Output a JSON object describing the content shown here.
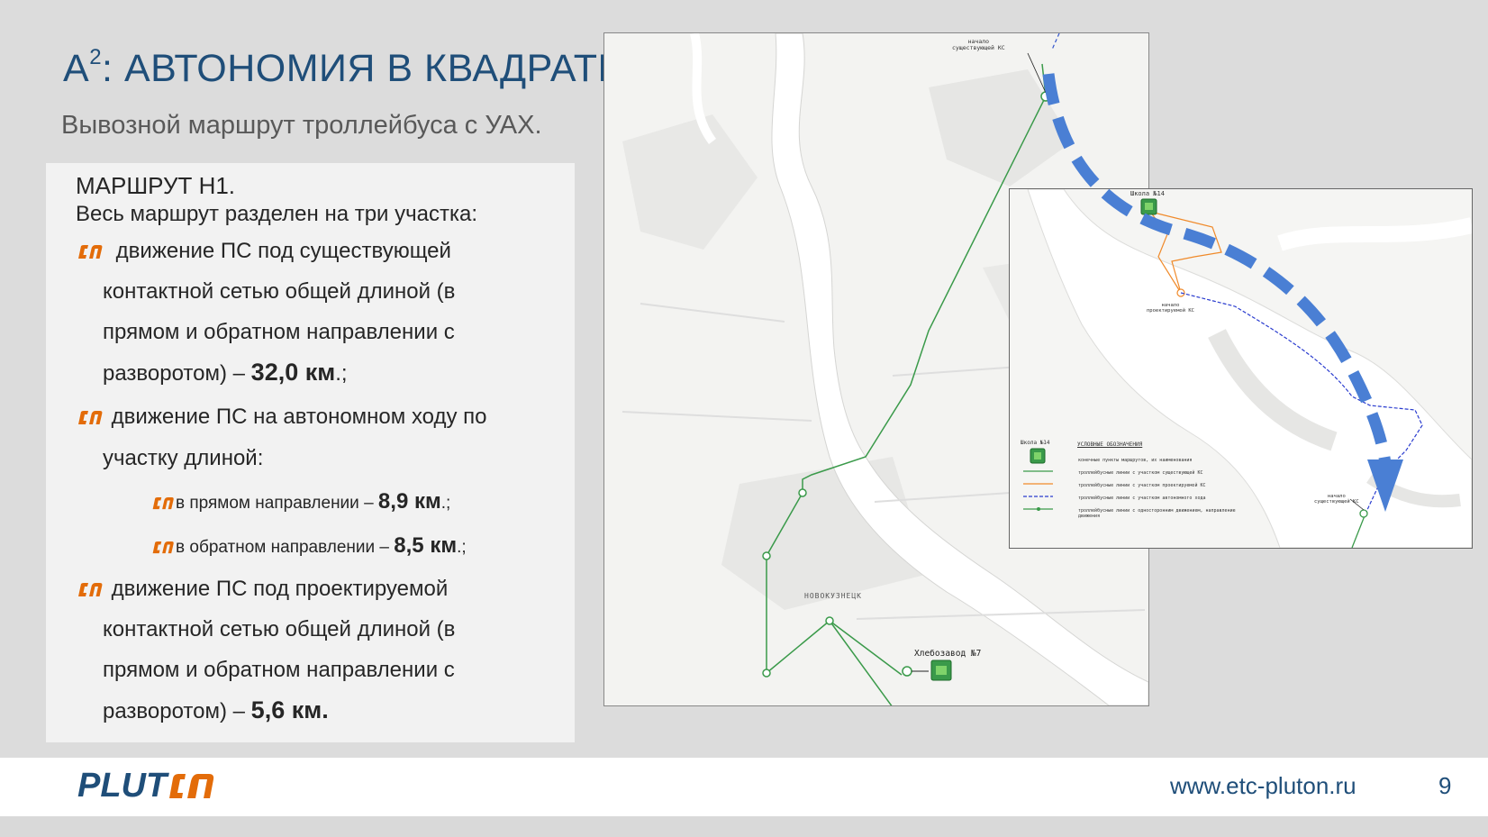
{
  "header": {
    "title_prefix": "А",
    "title_sup": "2",
    "title_rest": ": АВТОНОМИЯ В КВАДРАТЕ",
    "subtitle": "Вывозной маршрут троллейбуса с УАХ."
  },
  "content": {
    "route_heading": "МАРШРУТ Н1.",
    "intro": "Весь маршрут разделен на три участка:",
    "section1": {
      "line1": "движение ПС под существующей",
      "line2": "контактной сетью общей длиной (в",
      "line3": "прямом и обратном направлении с",
      "line4_prefix": "разворотом) – ",
      "line4_value": "32,0 км",
      "line4_suffix": ".;"
    },
    "section2": {
      "line1": "движение ПС на автономном ходу по",
      "line2": "участку длиной:",
      "sub1_prefix": "в прямом направлении – ",
      "sub1_value": "8,9 км",
      "sub1_suffix": ".;",
      "sub2_prefix": "в обратном направлении – ",
      "sub2_value": "8,5 км",
      "sub2_suffix": ".;"
    },
    "section3": {
      "line1": "движение ПС под проектируемой",
      "line2": "контактной сетью общей длиной (в",
      "line3": "прямом и обратном направлении с",
      "line4_prefix": "разворотом) – ",
      "line4_value": "5,6 км."
    }
  },
  "map_main": {
    "label_start": "начало",
    "label_start2": "существующей КС",
    "label_district": "НОВОКУЗНЕЦК",
    "label_depot": "Хлебозавод №7"
  },
  "map_inset": {
    "label_school": "Школа №14",
    "label_projected": "начало",
    "label_projected2": "проектируемой КС",
    "label_existing": "начало",
    "label_existing2": "существующей КС",
    "legend_title": "УСЛОВНЫЕ ОБОЗНАЧЕНИЯ",
    "legend_school": "Школа №14",
    "legend_items": [
      "конечные пункты маршрутов, их наименования",
      "троллейбусные линии с участком существующей КС",
      "троллейбусные линии с участком проектируемой КС",
      "троллейбусные линии с участком автономного хода",
      "троллейбусные линии с односторонним движением, направление движения"
    ]
  },
  "footer": {
    "logo_text": "PLUTON",
    "url": "www.etc-pluton.ru",
    "page_number": "9"
  },
  "colors": {
    "title": "#1f4e79",
    "accent_orange": "#e36c09",
    "route_green": "#3a9a4a",
    "arrow_blue": "#4a7fd4",
    "logo_blue": "#1f4e79"
  }
}
